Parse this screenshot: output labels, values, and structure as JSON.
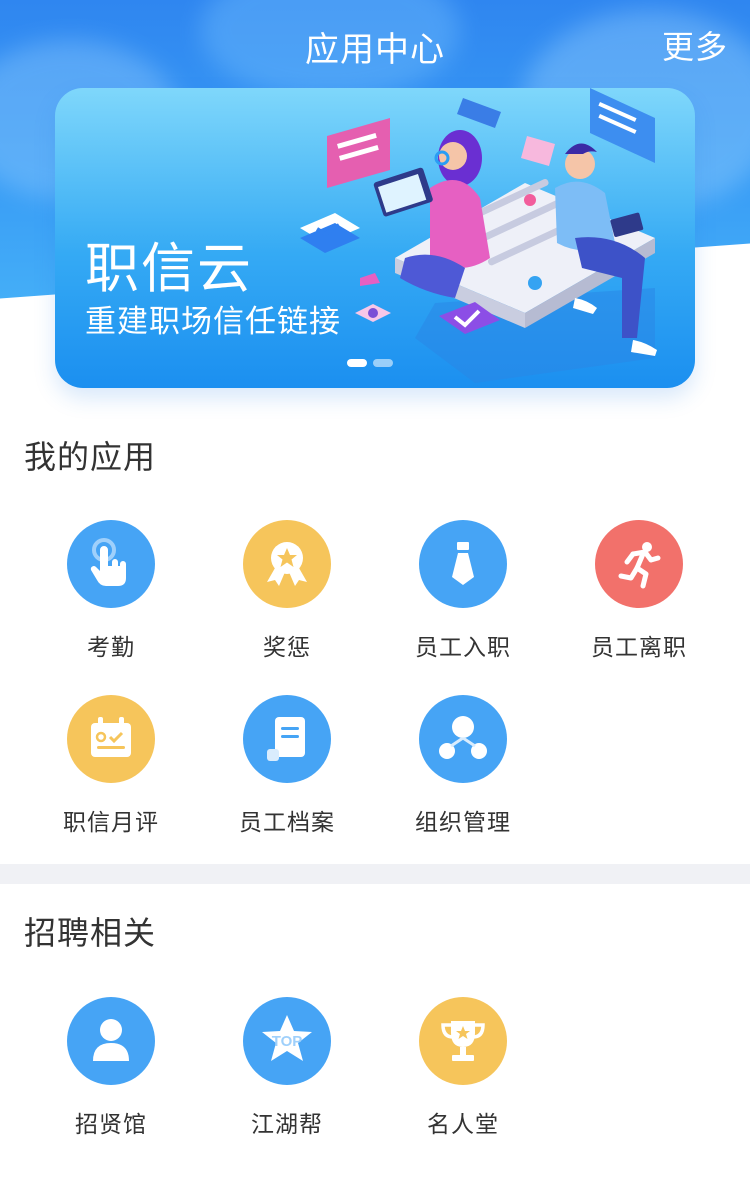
{
  "header": {
    "title": "应用中心",
    "more_label": "更多"
  },
  "banner": {
    "headline": "职信云",
    "subline": "重建职场信任链接",
    "slides_total": 2,
    "slide_active": 1
  },
  "my_apps": {
    "title": "我的应用",
    "items": [
      {
        "label": "考勤",
        "icon": "touch-hand-icon",
        "color": "#46a4f5"
      },
      {
        "label": "奖惩",
        "icon": "medal-icon",
        "color": "#f6c55b"
      },
      {
        "label": "员工入职",
        "icon": "tie-icon",
        "color": "#46a4f5"
      },
      {
        "label": "员工离职",
        "icon": "running-person-icon",
        "color": "#f2716b"
      },
      {
        "label": "职信月评",
        "icon": "calendar-check-icon",
        "color": "#f6c55b"
      },
      {
        "label": "员工档案",
        "icon": "document-scroll-icon",
        "color": "#46a4f5"
      },
      {
        "label": "组织管理",
        "icon": "org-structure-icon",
        "color": "#46a4f5"
      }
    ]
  },
  "recruit": {
    "title": "招聘相关",
    "items": [
      {
        "label": "招贤馆",
        "icon": "person-icon",
        "color": "#46a4f5"
      },
      {
        "label": "江湖帮",
        "icon": "top-star-icon",
        "color": "#46a4f5"
      },
      {
        "label": "名人堂",
        "icon": "trophy-icon",
        "color": "#f6c55b"
      }
    ]
  }
}
